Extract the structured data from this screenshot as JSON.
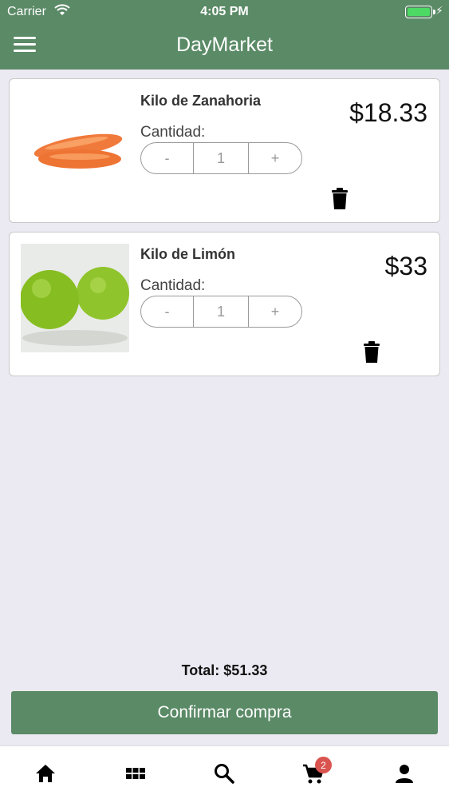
{
  "status_bar": {
    "carrier": "Carrier",
    "time": "4:05 PM"
  },
  "header": {
    "title": "DayMarket"
  },
  "cart": {
    "items": [
      {
        "name": "Kilo de Zanahoria",
        "quantity_label": "Cantidad:",
        "minus": "-",
        "quantity": "1",
        "plus": "+",
        "price": "$18.33"
      },
      {
        "name": "Kilo de Limón",
        "quantity_label": "Cantidad:",
        "minus": "-",
        "quantity": "1",
        "plus": "+",
        "price": "$33"
      }
    ],
    "total": "Total: $51.33",
    "confirm_label": "Confirmar compra"
  },
  "tabbar": {
    "cart_badge": "2",
    "icons": [
      "home-icon",
      "grid-icon",
      "search-icon",
      "cart-icon",
      "user-icon"
    ]
  },
  "colors": {
    "brand": "#5a8a66",
    "badge": "#d9534f",
    "background": "#ebe9f1"
  }
}
